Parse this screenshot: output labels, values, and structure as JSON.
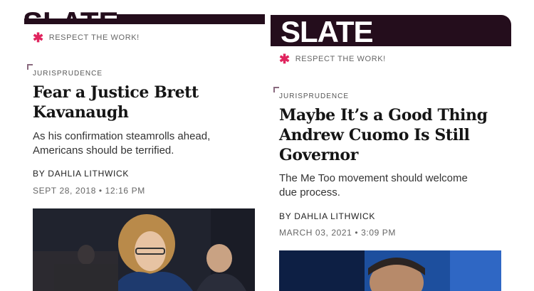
{
  "left_article": {
    "tagline": "RESPECT THE WORK!",
    "section": "JURISPRUDENCE",
    "headline_line1": "Fear a Justice Brett",
    "headline_line2": "Kavanaugh",
    "dek_line1": "As his confirmation steamrolls ahead,",
    "dek_line2": "Americans should be terrified.",
    "byline": "BY DAHLIA LITHWICK",
    "date": "SEPT 28, 2018 • 12:16 PM"
  },
  "right_article": {
    "logo": "SLATE",
    "tagline": "RESPECT THE WORK!",
    "section": "JURISPRUDENCE",
    "headline_line1": "Maybe It’s a Good Thing",
    "headline_line2": "Andrew Cuomo Is Still",
    "headline_line3": "Governor",
    "dek_line1": "The Me Too movement should welcome",
    "dek_line2": "due process.",
    "byline": "BY DAHLIA LITHWICK",
    "date": "MARCH 03, 2021 • 3:09 PM"
  },
  "colors": {
    "header_bg": "#240d1c",
    "accent_star": "#e0245e"
  }
}
